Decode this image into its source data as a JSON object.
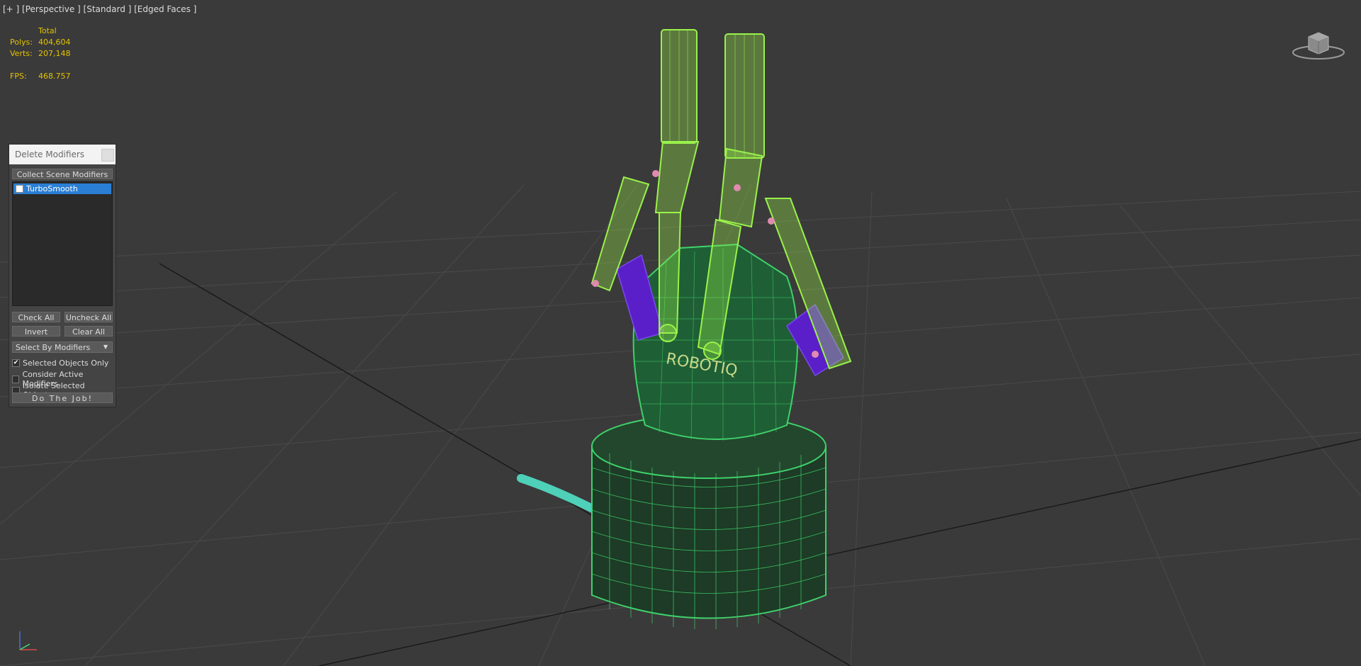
{
  "viewport": {
    "label": "[+ ] [Perspective ] [Standard ] [Edged Faces ]",
    "stats": {
      "header": "Total",
      "polys_label": "Polys:",
      "polys_value": "404,604",
      "verts_label": "Verts:",
      "verts_value": "207,148",
      "fps_label": "FPS:",
      "fps_value": "468.757"
    },
    "model_logo_text": "ROBOTIQ"
  },
  "dialog": {
    "title": "Delete Modifiers",
    "collect_button": "Collect Scene Modifiers",
    "list_items": [
      {
        "label": "TurboSmooth",
        "selected": true,
        "checked": false
      }
    ],
    "check_all": "Check All",
    "uncheck_all": "Uncheck All",
    "invert": "Invert",
    "clear_all": "Clear All",
    "select_by": "Select By Modifiers",
    "options": {
      "selected_objects_only": {
        "label": "Selected Objects Only",
        "checked": true
      },
      "consider_active_modifiers": {
        "label": "Consider Active Modifiers",
        "checked": false
      },
      "isolate_selected_objects": {
        "label": "Isolate Selected Objects",
        "checked": false
      }
    },
    "do_job": "Do The Job!"
  },
  "colors": {
    "viewport_bg": "#3a3a3a",
    "stats_text": "#e3c300",
    "wire_green": "#3fd16b",
    "wire_lime": "#9af24a",
    "wire_purple": "#5a1fc8",
    "wire_cyan": "#4fd0b8",
    "selection": "#2a7fd4"
  }
}
